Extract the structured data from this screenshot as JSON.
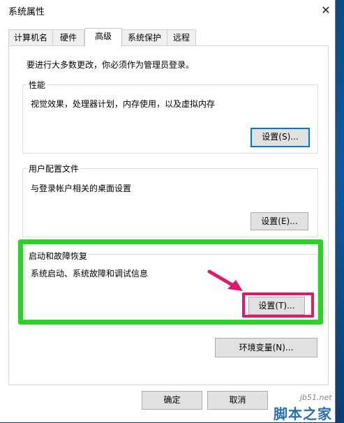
{
  "window": {
    "title": "系统属性",
    "close_symbol": "✕"
  },
  "tabs": [
    {
      "label": "计算机名"
    },
    {
      "label": "硬件"
    },
    {
      "label": "高级"
    },
    {
      "label": "系统保护"
    },
    {
      "label": "远程"
    }
  ],
  "active_tab": "高级",
  "admin_note": "要进行大多数更改，你必须作为管理员登录。",
  "performance": {
    "title": "性能",
    "description": "视觉效果，处理器计划，内存使用，以及虚拟内存",
    "button": "设置(S)..."
  },
  "user_profiles": {
    "title": "用户配置文件",
    "description": "与登录帐户相关的桌面设置",
    "button": "设置(E)..."
  },
  "startup_recovery": {
    "title": "启动和故障恢复",
    "description": "系统启动、系统故障和调试信息",
    "button": "设置(T)..."
  },
  "env_button": "环境变量(N)...",
  "footer": {
    "ok": "确定",
    "cancel": "取消"
  },
  "watermark": {
    "url": "jb51.net",
    "name": "脚本之家"
  },
  "colors": {
    "highlight": "#2fd02c",
    "annotation": "#e0196b",
    "focus": "#0078d7"
  }
}
